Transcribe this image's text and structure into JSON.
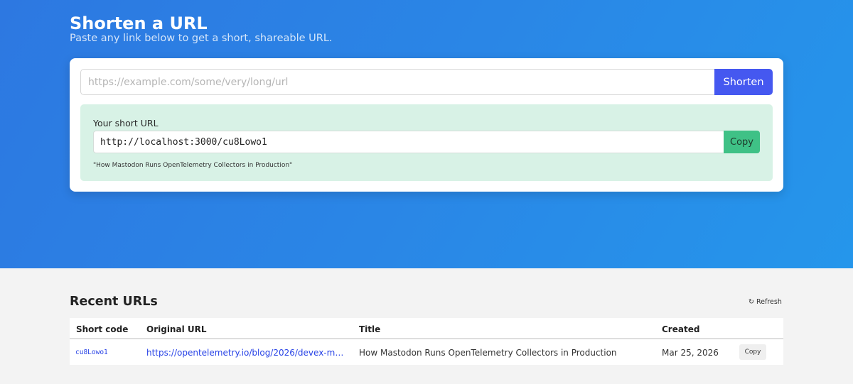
{
  "header": {
    "title": "Shorten a URL",
    "subtitle": "Paste any link below to get a short, shareable URL."
  },
  "form": {
    "input_placeholder": "https://example.com/some/very/long/url",
    "input_value": "",
    "submit_label": "Shorten"
  },
  "result": {
    "label": "Your short URL",
    "short_url": "http://localhost:3000/cu8Lowo1",
    "copy_label": "Copy",
    "page_title": "\"How Mastodon Runs OpenTelemetry Collectors in Production\""
  },
  "recent": {
    "title": "Recent URLs",
    "refresh_icon": "refresh-icon",
    "refresh_glyph": "↻",
    "refresh_label": "Refresh",
    "columns": [
      "Short code",
      "Original URL",
      "Title",
      "Created"
    ],
    "rows": [
      {
        "short_code": "cu8Lowo1",
        "original_url": "https://opentelemetry.io/blog/2026/devex-mastod...",
        "title": "How Mastodon Runs OpenTelemetry Collectors in Production",
        "created": "Mar 25, 2026",
        "copy_label": "Copy"
      }
    ]
  },
  "colors": {
    "hero_gradient_start": "#2d78e1",
    "hero_gradient_end": "#2596eb",
    "shorten_button": "#4558f0",
    "result_background": "#d8f2e6",
    "copy_button": "#3fc186",
    "link": "#2742e6"
  }
}
